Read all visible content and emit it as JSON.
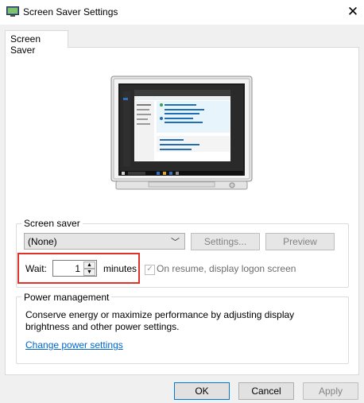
{
  "window": {
    "title": "Screen Saver Settings",
    "close_glyph": "✕"
  },
  "tab": {
    "label": "Screen Saver"
  },
  "screen_saver": {
    "group_label": "Screen saver",
    "selected": "(None)",
    "settings_label": "Settings...",
    "preview_label": "Preview",
    "wait_label": "Wait:",
    "wait_value": "1",
    "minutes_label": "minutes",
    "resume_label": "On resume, display logon screen"
  },
  "power": {
    "group_label": "Power management",
    "description": "Conserve energy or maximize performance by adjusting display brightness and other power settings.",
    "link_label": "Change power settings"
  },
  "buttons": {
    "ok": "OK",
    "cancel": "Cancel",
    "apply": "Apply"
  },
  "colors": {
    "highlight": "#e0312a",
    "link": "#0066cc"
  }
}
